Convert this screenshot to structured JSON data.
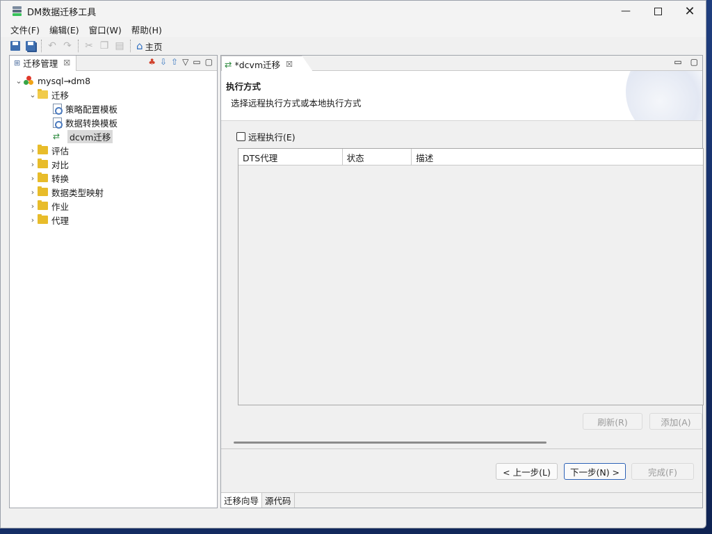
{
  "window": {
    "title": "DM数据迁移工具"
  },
  "menubar": [
    {
      "label": "文件(F)"
    },
    {
      "label": "编辑(E)"
    },
    {
      "label": "窗口(W)"
    },
    {
      "label": "帮助(H)"
    }
  ],
  "toolbar": {
    "home_label": "主页"
  },
  "left_panel": {
    "tab_label": "迁移管理",
    "tree": {
      "root_label": "mysql→dm8",
      "migrate_folder": "迁移",
      "migrate_children": [
        "策略配置模板",
        "数据转换模板",
        "dcvm迁移"
      ],
      "folders": [
        "评估",
        "对比",
        "转换",
        "数据类型映射",
        "作业",
        "代理"
      ]
    }
  },
  "editor": {
    "tab_label": "*dcvm迁移",
    "wizard_title": "执行方式",
    "wizard_desc": "选择远程执行方式或本地执行方式",
    "remote_checkbox_label": "远程执行(E)",
    "remote_checked": false,
    "table_columns": [
      "DTS代理",
      "状态",
      "描述"
    ],
    "refresh_label": "刷新(R)",
    "add_label": "添加(A)",
    "back_label": "< 上一步(L)",
    "next_label": "下一步(N) >",
    "finish_label": "完成(F)",
    "bottom_tabs": [
      "迁移向导",
      "源代码"
    ]
  },
  "colors": {
    "accent": "#2a5fb4",
    "folder": "#e8bc2a"
  }
}
